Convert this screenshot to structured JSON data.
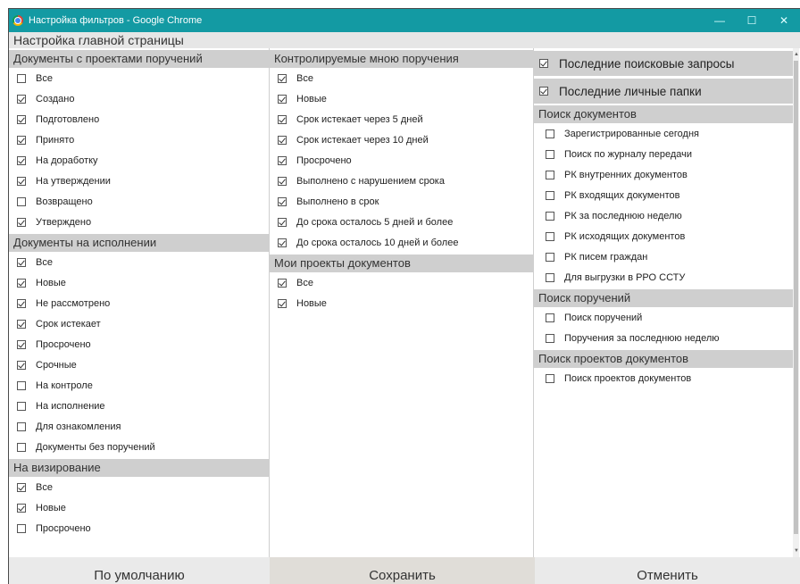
{
  "window": {
    "title": "Настройка фильтров - Google Chrome",
    "controls": {
      "minimize": "—",
      "maximize": "☐",
      "close": "✕"
    }
  },
  "page_title": "Настройка главной страницы",
  "column1": [
    {
      "title": "Документы с проектами поручений",
      "items": [
        {
          "label": "Все",
          "checked": false
        },
        {
          "label": "Создано",
          "checked": true
        },
        {
          "label": "Подготовлено",
          "checked": true
        },
        {
          "label": "Принято",
          "checked": true
        },
        {
          "label": "На доработку",
          "checked": true
        },
        {
          "label": "На утверждении",
          "checked": true
        },
        {
          "label": "Возвращено",
          "checked": false
        },
        {
          "label": "Утверждено",
          "checked": true
        }
      ]
    },
    {
      "title": "Документы на исполнении",
      "items": [
        {
          "label": "Все",
          "checked": true
        },
        {
          "label": "Новые",
          "checked": true
        },
        {
          "label": "Не рассмотрено",
          "checked": true
        },
        {
          "label": "Срок истекает",
          "checked": true
        },
        {
          "label": "Просрочено",
          "checked": true
        },
        {
          "label": "Срочные",
          "checked": true
        },
        {
          "label": "На контроле",
          "checked": false
        },
        {
          "label": "На исполнение",
          "checked": false
        },
        {
          "label": "Для ознакомления",
          "checked": false
        },
        {
          "label": "Документы без поручений",
          "checked": false
        }
      ]
    },
    {
      "title": "На визирование",
      "items": [
        {
          "label": "Все",
          "checked": true
        },
        {
          "label": "Новые",
          "checked": true
        },
        {
          "label": "Просрочено",
          "checked": false
        }
      ]
    }
  ],
  "column2": [
    {
      "title": "Контролируемые мною поручения",
      "items": [
        {
          "label": "Все",
          "checked": true
        },
        {
          "label": "Новые",
          "checked": true
        },
        {
          "label": "Срок истекает через 5 дней",
          "checked": true
        },
        {
          "label": "Срок истекает через 10 дней",
          "checked": true
        },
        {
          "label": "Просрочено",
          "checked": true
        },
        {
          "label": "Выполнено с нарушением срока",
          "checked": true
        },
        {
          "label": "Выполнено в срок",
          "checked": true
        },
        {
          "label": "До срока осталось 5 дней и более",
          "checked": true
        },
        {
          "label": "До срока осталось 10 дней и более",
          "checked": true
        }
      ]
    },
    {
      "title": "Мои проекты документов",
      "items": [
        {
          "label": "Все",
          "checked": true
        },
        {
          "label": "Новые",
          "checked": true
        }
      ]
    }
  ],
  "column3_top": [
    {
      "label": "Последние поисковые запросы",
      "checked": true
    },
    {
      "label": "Последние личные папки",
      "checked": true
    }
  ],
  "column3": [
    {
      "title": "Поиск документов",
      "items": [
        {
          "label": "Зарегистрированные сегодня",
          "checked": false
        },
        {
          "label": "Поиск по журналу передачи",
          "checked": false
        },
        {
          "label": "РК внутренних документов",
          "checked": false
        },
        {
          "label": "РК входящих документов",
          "checked": false
        },
        {
          "label": "РК за последнюю неделю",
          "checked": false
        },
        {
          "label": "РК исходящих документов",
          "checked": false
        },
        {
          "label": "РК писем граждан",
          "checked": false
        },
        {
          "label": "Для выгрузки в РРО ССТУ",
          "checked": false
        }
      ]
    },
    {
      "title": "Поиск поручений",
      "items": [
        {
          "label": "Поиск поручений",
          "checked": false
        },
        {
          "label": "Поручения за последнюю неделю",
          "checked": false
        }
      ]
    },
    {
      "title": "Поиск проектов документов",
      "items": [
        {
          "label": "Поиск проектов документов",
          "checked": false
        }
      ]
    }
  ],
  "footer": {
    "default_label": "По умолчанию",
    "save_label": "Сохранить",
    "cancel_label": "Отменить"
  }
}
